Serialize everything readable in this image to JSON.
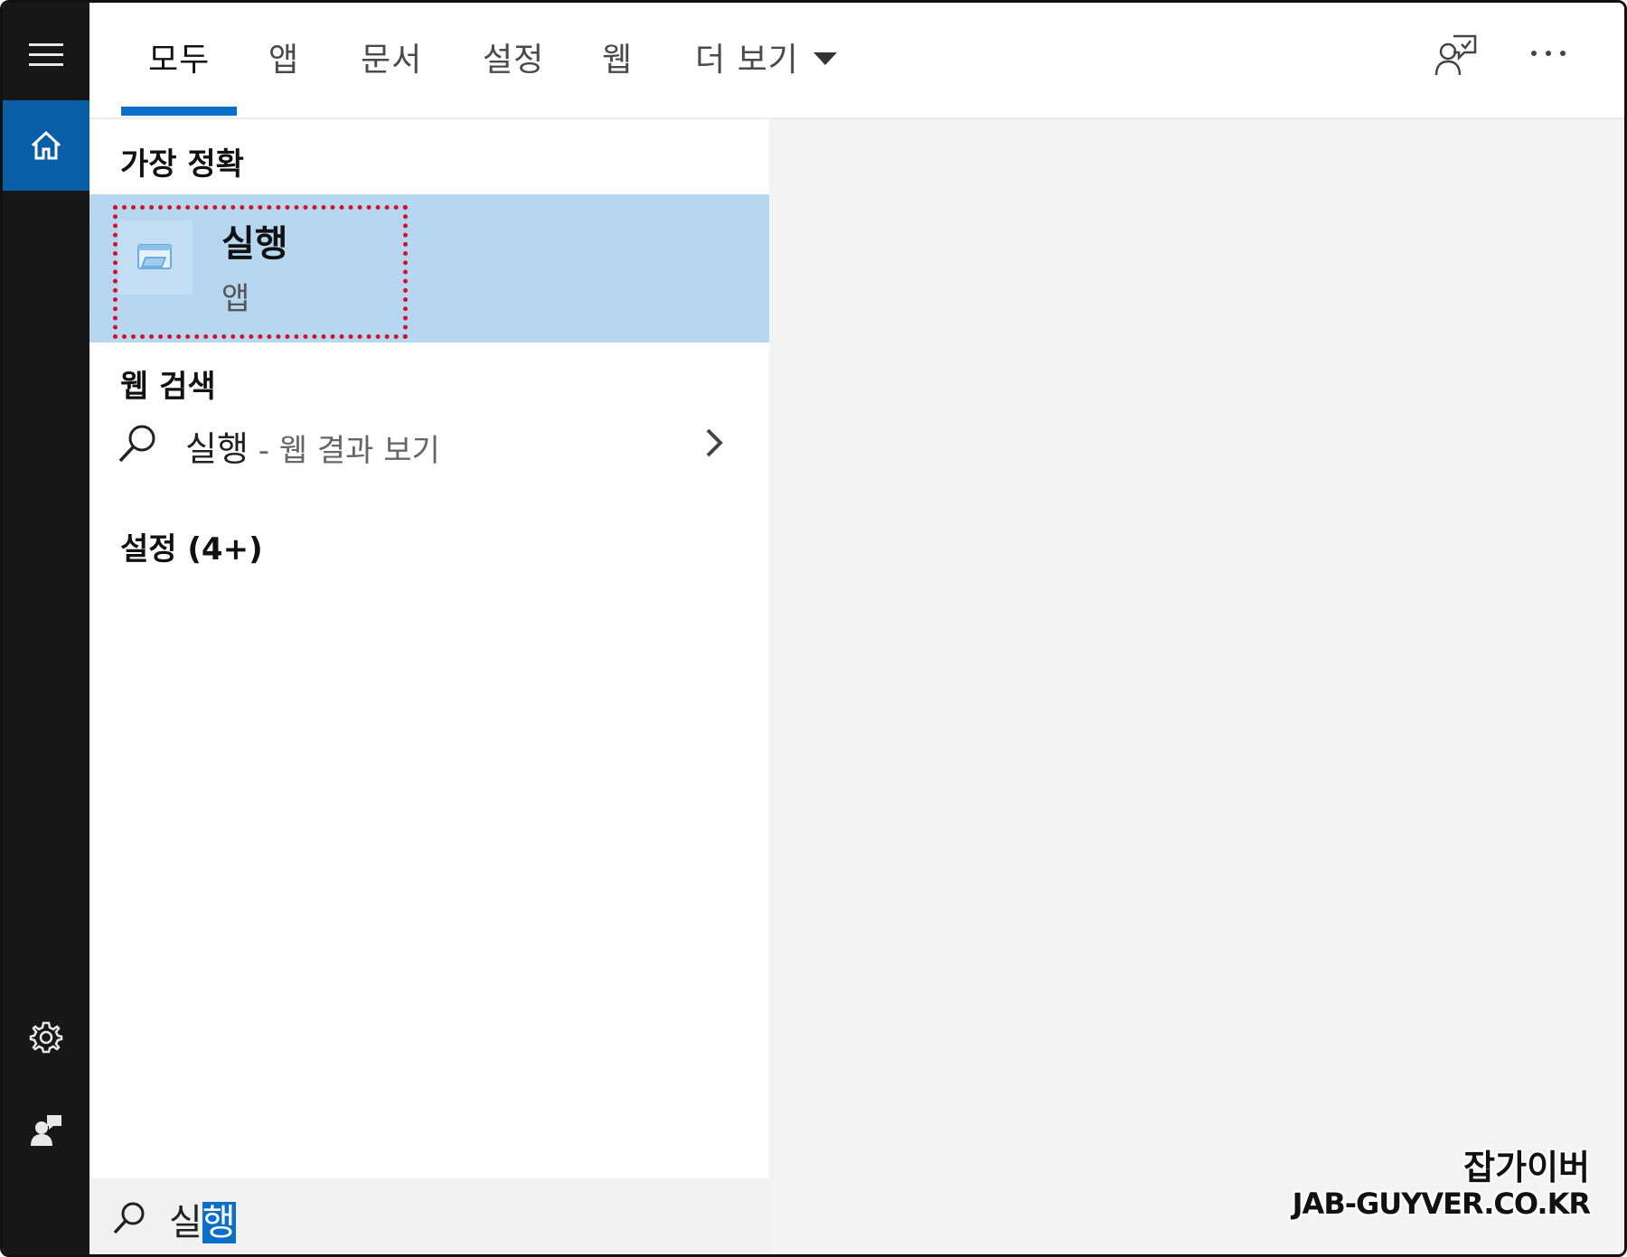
{
  "tabs": {
    "all": "모두",
    "apps": "앱",
    "documents": "문서",
    "settings": "설정",
    "web": "웹",
    "more": "더 보기"
  },
  "best_match": {
    "heading": "가장 정확",
    "title": "실행",
    "subtitle": "앱",
    "icon": "run-app-icon"
  },
  "web_search": {
    "heading": "웹 검색",
    "query": "실행",
    "suffix": " - 웹 결과 보기"
  },
  "settings_section": {
    "heading": "설정 (4+)"
  },
  "search_box": {
    "typed": "실",
    "selected": "행"
  },
  "watermark": {
    "line1": "잡가이버",
    "line2": "JAB-GUYVER.CO.KR"
  },
  "colors": {
    "accent": "#0a6fc7",
    "rail": "#171717",
    "rail_active": "#0a5ea8",
    "highlight": "#b7d7f1",
    "annotation": "#d0142b"
  }
}
